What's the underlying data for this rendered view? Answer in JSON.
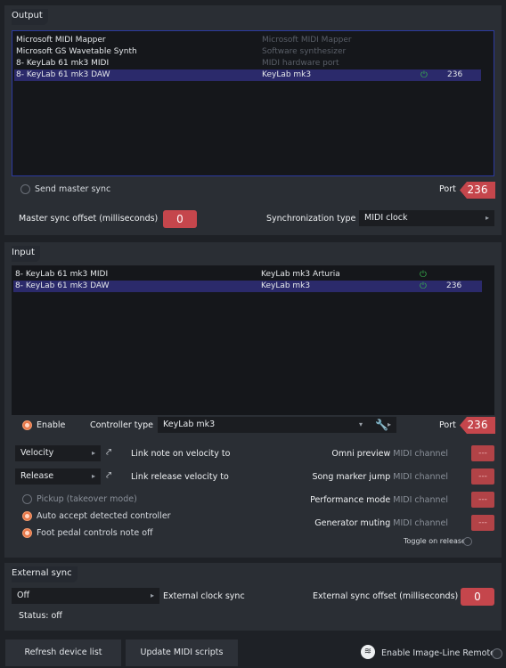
{
  "output": {
    "title": "Output",
    "devices": [
      {
        "name": "Microsoft MIDI Mapper",
        "controller": "Microsoft MIDI Mapper",
        "power": "",
        "port": "",
        "selected": false,
        "dim": true
      },
      {
        "name": "Microsoft GS Wavetable Synth",
        "controller": "Software synthesizer",
        "power": "",
        "port": "",
        "selected": false,
        "dim": true
      },
      {
        "name": "8- KeyLab 61 mk3 MIDI",
        "controller": "MIDI hardware port",
        "power": "",
        "port": "",
        "selected": false,
        "dim": true
      },
      {
        "name": "8- KeyLab 61 mk3 DAW",
        "controller": "KeyLab mk3",
        "power": "⏻",
        "port": "236",
        "selected": true,
        "dim": false
      }
    ],
    "send_master_sync_label": "Send master sync",
    "port_label": "Port",
    "port_value": "236",
    "master_sync_offset_label": "Master sync offset (milliseconds)",
    "master_sync_offset_value": "0",
    "sync_type_label": "Synchronization type",
    "sync_type_value": "MIDI clock"
  },
  "input": {
    "title": "Input",
    "devices": [
      {
        "name": "8- KeyLab 61 mk3 MIDI",
        "controller": "KeyLab mk3 Arturia",
        "power": "⏻",
        "port": "",
        "selected": false
      },
      {
        "name": "8- KeyLab 61 mk3 DAW",
        "controller": "KeyLab mk3",
        "power": "⏻",
        "port": "236",
        "selected": true
      }
    ],
    "enable_label": "Enable",
    "controller_type_label": "Controller type",
    "controller_type_value": "KeyLab mk3",
    "port_label": "Port",
    "port_value": "236",
    "velocity_value": "Velocity",
    "link_velocity_label": "Link note on velocity to",
    "release_value": "Release",
    "link_release_label": "Link release velocity to",
    "pickup_label": "Pickup (takeover mode)",
    "auto_accept_label": "Auto accept detected controller",
    "foot_pedal_label": "Foot pedal controls note off",
    "omni_preview_label": "Omni preview",
    "song_marker_label": "Song marker jump",
    "performance_mode_label": "Performance mode",
    "generator_muting_label": "Generator muting",
    "midi_channel_label": "MIDI channel",
    "midi_channel_value": "---",
    "toggle_on_release_label": "Toggle on release"
  },
  "external_sync": {
    "title": "External sync",
    "clock_value": "Off",
    "clock_label": "External clock sync",
    "offset_label": "External sync offset (milliseconds)",
    "offset_value": "0",
    "status": "Status: off"
  },
  "footer": {
    "refresh_label": "Refresh device list",
    "update_scripts_label": "Update MIDI scripts",
    "remote_label": "Enable Image-Line Remote"
  }
}
